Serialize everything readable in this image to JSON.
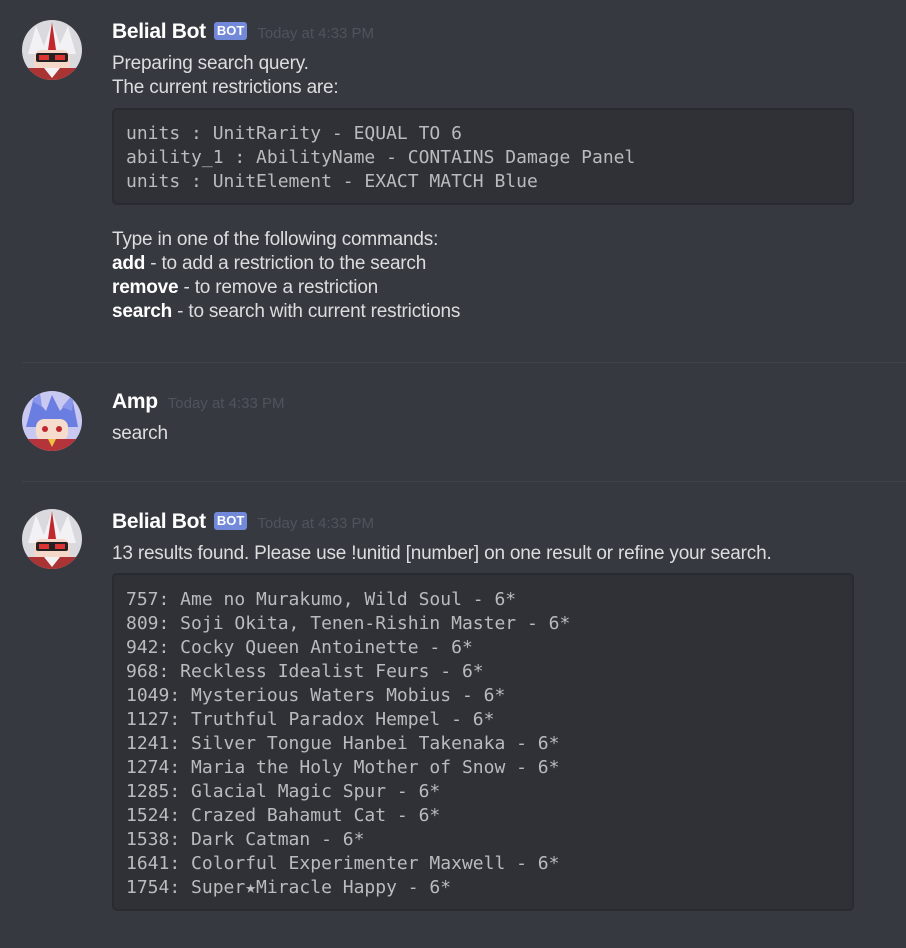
{
  "messages": [
    {
      "author": "Belial Bot",
      "bot_tag": "BOT",
      "timestamp": "Today at 4:33 PM",
      "intro_lines": [
        "Preparing search query.",
        "The current restrictions are:"
      ],
      "code_lines": [
        "units : UnitRarity - EQUAL TO 6",
        "ability_1 : AbilityName - CONTAINS Damage Panel",
        "units : UnitElement - EXACT MATCH Blue"
      ],
      "instructions_header": "Type in one of the following commands:",
      "commands": [
        {
          "name": "add",
          "desc": " - to add a restriction to the search"
        },
        {
          "name": "remove",
          "desc": " - to remove a restriction"
        },
        {
          "name": "search",
          "desc": " - to search with current restrictions"
        }
      ]
    },
    {
      "author": "Amp",
      "timestamp": "Today at 4:33 PM",
      "text": "search"
    },
    {
      "author": "Belial Bot",
      "bot_tag": "BOT",
      "timestamp": "Today at 4:33 PM",
      "text": "13 results found. Please use !unitid [number] on one result or refine your search.",
      "results": [
        "757: Ame no Murakumo, Wild Soul - 6*",
        "809: Soji Okita, Tenen-Rishin Master - 6*",
        "942: Cocky Queen Antoinette - 6*",
        "968: Reckless Idealist Feurs - 6*",
        "1049: Mysterious Waters Mobius - 6*",
        "1127: Truthful Paradox Hempel - 6*",
        "1241: Silver Tongue Hanbei Takenaka - 6*",
        "1274: Maria the Holy Mother of Snow - 6*",
        "1285: Glacial Magic Spur - 6*",
        "1524: Crazed Bahamut Cat - 6*",
        "1538: Dark Catman - 6*",
        "1641: Colorful Experimenter Maxwell - 6*",
        "1754: Super★Miracle Happy - 6*"
      ]
    }
  ],
  "colors": {
    "background": "#36393f",
    "codeblock_bg": "#2f3136",
    "bot_tag": "#7289da",
    "timestamp": "#4f545c"
  }
}
